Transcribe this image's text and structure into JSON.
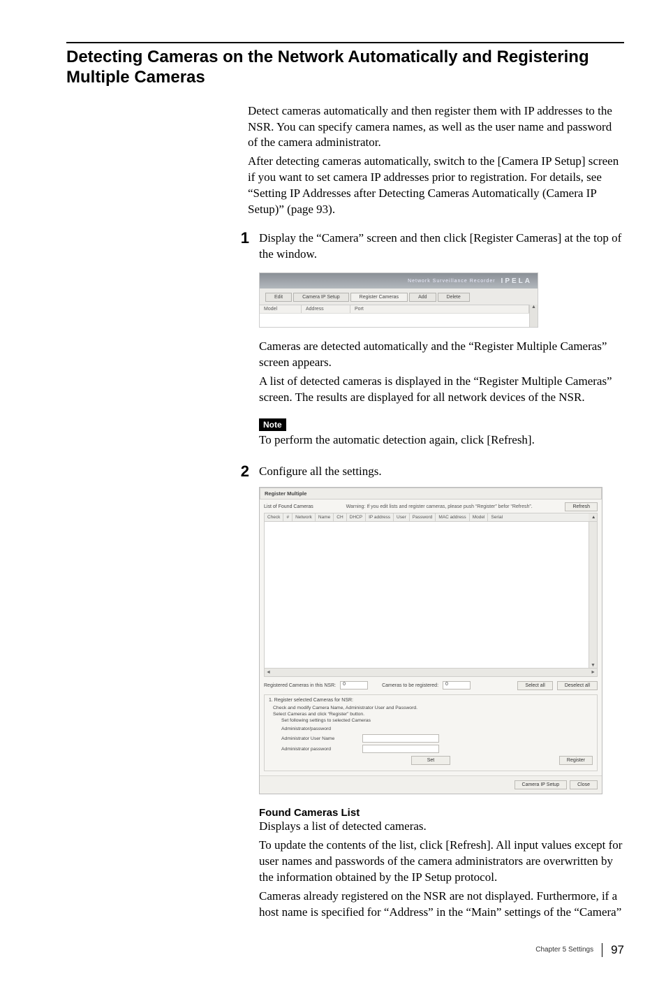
{
  "title": "Detecting Cameras on the Network Automatically and Registering Multiple Cameras",
  "intro_p1": "Detect cameras automatically and then register them with IP addresses to the NSR. You can specify camera names, as well as the user name and password of the camera administrator.",
  "intro_p2": "After detecting cameras automatically, switch to the [Camera IP Setup] screen if you want to set camera IP addresses prior to registration. For details, see “Setting IP Addresses after Detecting Cameras Automatically (Camera IP Setup)” (page 93).",
  "step1": {
    "num": "1",
    "text": "Display the “Camera” screen and then click [Register Cameras] at the top of the window.",
    "after_p1": "Cameras are detected automatically and the “Register Multiple Cameras” screen appears.",
    "after_p2": "A list of detected cameras is displayed in the “Register Multiple Cameras” screen. The results are displayed for all network devices of the NSR.",
    "note_label": "Note",
    "note_text": "To perform the automatic detection again, click [Refresh]."
  },
  "step2": {
    "num": "2",
    "text": "Configure all the settings."
  },
  "fig1": {
    "recorder_label": "Network Surveillance Recorder",
    "brand": "IPELA",
    "tabs": [
      "Edit",
      "Camera IP Setup",
      "Register Cameras",
      "Add",
      "Delete"
    ],
    "cols": [
      "Model",
      "Address",
      "Port"
    ]
  },
  "fig2": {
    "title_bar": "Register Multiple",
    "list_label": "List of Found Cameras",
    "warning": "Warning: If you edit lists and register cameras, please push “Register” befor “Refresh”.",
    "refresh": "Refresh",
    "cols": [
      "Check",
      "#",
      "Network",
      "Name",
      "CH",
      "DHCP",
      "IP address",
      "User",
      "Password",
      "MAC address",
      "Model",
      "Serial"
    ],
    "registered_label": "Registered Cameras in this NSR:",
    "registered_value": "0",
    "tobe_label": "Cameras to be registered:",
    "tobe_value": "0",
    "select_all": "Select all",
    "deselect_all": "Deselect all",
    "section_heading": "1. Register selected Cameras for NSR:",
    "line1": "Check and modify Camera Name, Administrator User and Password.",
    "line2": "Select Cameras and click “Register” button.",
    "line3": "Set following settings to selected Cameras",
    "admin_heading": "Administrator/password",
    "admin_user": "Administrator User Name",
    "admin_pass": "Administrator password",
    "set_btn": "Set",
    "register_btn": "Register",
    "footer_camera_ip": "Camera IP Setup",
    "footer_close": "Close"
  },
  "found_cameras": {
    "heading": "Found Cameras List",
    "p1": "Displays a list of detected cameras.",
    "p2": "To update the contents of the list, click [Refresh]. All input values except for user names and passwords of the camera administrators are overwritten by the information obtained by the IP Setup protocol.",
    "p3": "Cameras already registered on the NSR are not displayed. Furthermore, if a host name is specified for “Address” in the “Main” settings of the “Camera”"
  },
  "footer": {
    "chapter": "Chapter 5  Settings",
    "page": "97"
  }
}
